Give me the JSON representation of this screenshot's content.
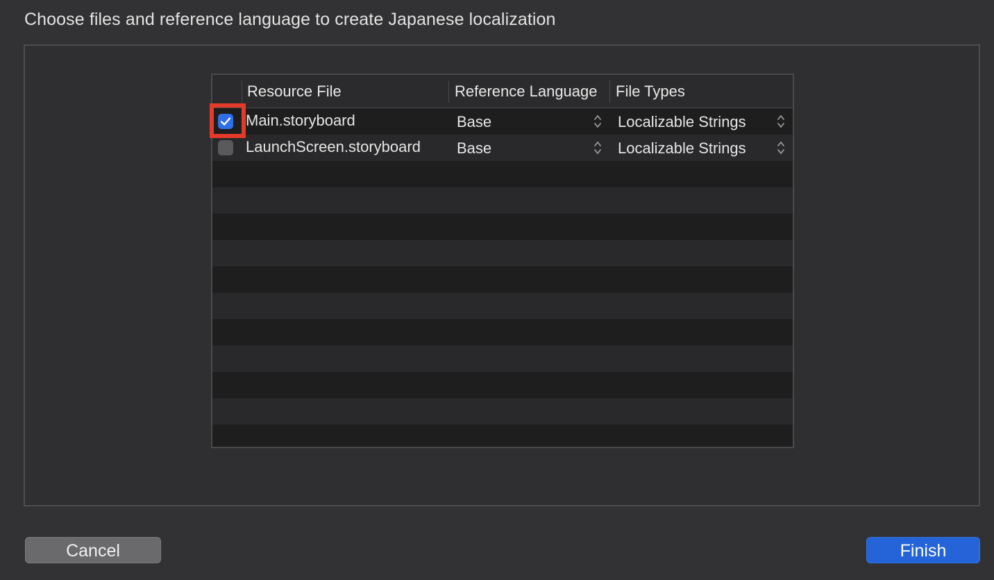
{
  "dialog": {
    "title": "Choose files and reference language to create Japanese localization"
  },
  "table": {
    "columns": {
      "resource_file": "Resource File",
      "reference_language": "Reference Language",
      "file_types": "File Types"
    },
    "rows": [
      {
        "checked": true,
        "file": "Main.storyboard",
        "reference_language": "Base",
        "file_type": "Localizable Strings"
      },
      {
        "checked": false,
        "file": "LaunchScreen.storyboard",
        "reference_language": "Base",
        "file_type": "Localizable Strings"
      }
    ]
  },
  "buttons": {
    "cancel": "Cancel",
    "finish": "Finish"
  },
  "colors": {
    "accent": "#2463d8",
    "highlight": "#e53a2a",
    "background": "#323234"
  },
  "icons": {
    "checkbox_checked": "checkmark-icon",
    "stepper": "up-down-chevron-icon"
  }
}
